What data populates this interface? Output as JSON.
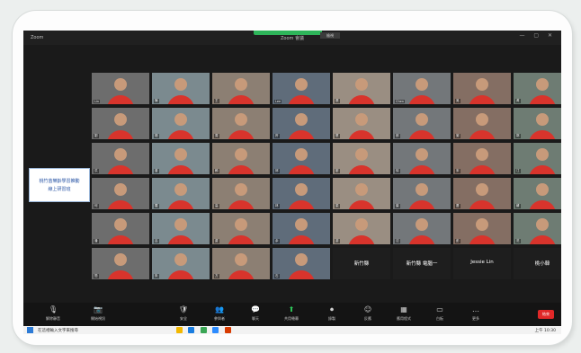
{
  "window": {
    "app_label": "Zoom",
    "title": "Zoom 會議",
    "view_button": "檢視",
    "close_glyphs": "— ▢ ✕"
  },
  "side_tile": {
    "line1": "桃竹苗樂齡學習推動",
    "line2": "線上研習班"
  },
  "participants": [
    {
      "name": "Lin",
      "dark": false
    },
    {
      "name": "陳",
      "dark": false
    },
    {
      "name": "王",
      "dark": false
    },
    {
      "name": "Lee",
      "dark": false
    },
    {
      "name": "張",
      "dark": false
    },
    {
      "name": "Chen",
      "dark": false
    },
    {
      "name": "吳",
      "dark": false
    },
    {
      "name": "黃",
      "dark": false
    },
    {
      "name": "劉",
      "dark": false
    },
    {
      "name": "楊",
      "dark": false
    },
    {
      "name": "周",
      "dark": false
    },
    {
      "name": "許",
      "dark": false
    },
    {
      "name": "蔡",
      "dark": false
    },
    {
      "name": "鄭",
      "dark": false
    },
    {
      "name": "謝",
      "dark": false
    },
    {
      "name": "郭",
      "dark": false
    },
    {
      "name": "洪",
      "dark": false
    },
    {
      "name": "曾",
      "dark": false
    },
    {
      "name": "賴",
      "dark": false
    },
    {
      "name": "邱",
      "dark": false
    },
    {
      "name": "廖",
      "dark": false
    },
    {
      "name": "徐",
      "dark": false
    },
    {
      "name": "宋",
      "dark": false
    },
    {
      "name": "江",
      "dark": false
    },
    {
      "name": "何",
      "dark": false
    },
    {
      "name": "羅",
      "dark": false
    },
    {
      "name": "高",
      "dark": false
    },
    {
      "name": "林",
      "dark": false
    },
    {
      "name": "梁",
      "dark": false
    },
    {
      "name": "葉",
      "dark": false
    },
    {
      "name": "蕭",
      "dark": false
    },
    {
      "name": "蘇",
      "dark": false
    },
    {
      "name": "潘",
      "dark": false
    },
    {
      "name": "呂",
      "dark": false
    },
    {
      "name": "盧",
      "dark": false
    },
    {
      "name": "余",
      "dark": false
    },
    {
      "name": "游",
      "dark": false
    },
    {
      "name": "沈",
      "dark": false
    },
    {
      "name": "彭",
      "dark": false
    },
    {
      "name": "范",
      "dark": false
    },
    {
      "name": "簡",
      "dark": false
    },
    {
      "name": "朱",
      "dark": false
    },
    {
      "name": "方",
      "dark": false
    },
    {
      "name": "石",
      "dark": false
    },
    {
      "name": "新竹縣",
      "dark": true
    },
    {
      "name": "新竹縣 電腦一",
      "dark": true
    },
    {
      "name": "Jessie Lin",
      "dark": true
    },
    {
      "name": "桃小韓",
      "dark": true
    }
  ],
  "toolbar": {
    "items": [
      {
        "label": "解除靜音",
        "icon": "🎙"
      },
      {
        "label": "開始視訊",
        "icon": "📷"
      },
      {
        "label": "安全",
        "icon": "🛡"
      },
      {
        "label": "參與者",
        "icon": "👥"
      },
      {
        "label": "聊天",
        "icon": "💬"
      },
      {
        "label": "共用螢幕",
        "icon": "⬆"
      },
      {
        "label": "錄製",
        "icon": "⏺"
      },
      {
        "label": "反應",
        "icon": "☺"
      },
      {
        "label": "應用程式",
        "icon": "▦"
      },
      {
        "label": "白板",
        "icon": "▭"
      },
      {
        "label": "更多",
        "icon": "…"
      }
    ],
    "leave": "結束"
  },
  "taskbar": {
    "search_placeholder": "在這裡輸入文字來搜尋",
    "clock": "上午 10:30"
  }
}
